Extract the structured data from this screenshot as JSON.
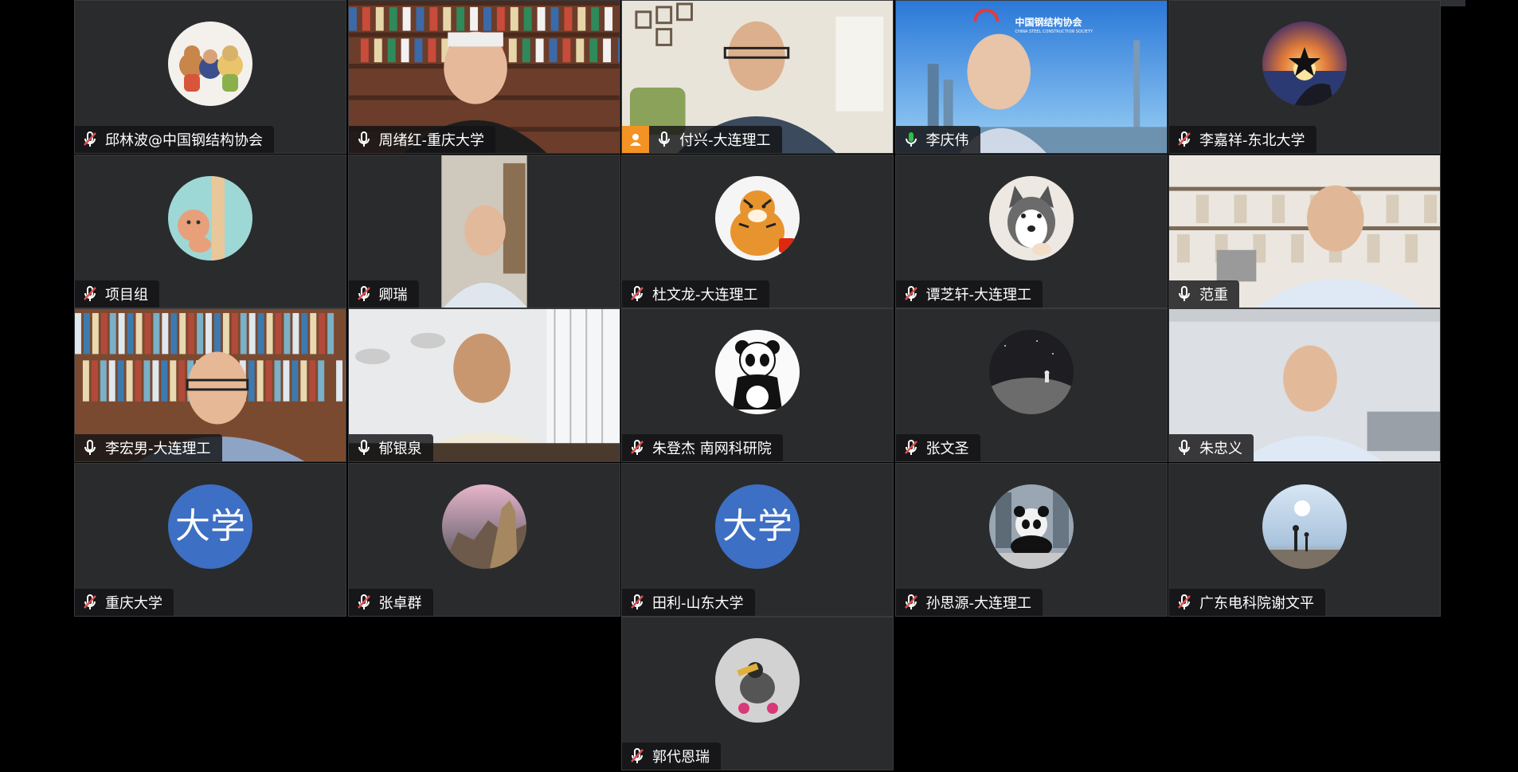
{
  "participants": [
    {
      "name": "邱林波@中国钢结构协会",
      "mic": "muted",
      "type": "avatar",
      "avatar": "teddy-bears-avatar"
    },
    {
      "name": "周绪红-重庆大学",
      "mic": "on",
      "type": "video",
      "scene": "bookshelf-man"
    },
    {
      "name": "付兴-大连理工",
      "mic": "on",
      "type": "video",
      "scene": "room-man",
      "host_badge": "host-icon"
    },
    {
      "name": "李庆伟",
      "mic": "speaking",
      "type": "video",
      "scene": "city-banner",
      "banner_text": "中国钢结构协会",
      "banner_sub": "CHINA STEEL CONSTRUCTION SOCIETY"
    },
    {
      "name": "李嘉祥-东北大学",
      "mic": "muted",
      "type": "avatar",
      "avatar": "sunset-avatar"
    },
    {
      "name": "项目组",
      "mic": "muted",
      "type": "avatar",
      "avatar": "cartoon-avatar"
    },
    {
      "name": "卿瑞",
      "mic": "muted",
      "type": "video",
      "scene": "portrait-narrow"
    },
    {
      "name": "杜文龙-大连理工",
      "mic": "muted",
      "type": "avatar",
      "avatar": "tiger-avatar"
    },
    {
      "name": "谭芝轩-大连理工",
      "mic": "muted",
      "type": "avatar",
      "avatar": "husky-avatar"
    },
    {
      "name": "范重",
      "mic": "on",
      "type": "video",
      "scene": "shelf-man"
    },
    {
      "name": "李宏男-大连理工",
      "mic": "on",
      "type": "video",
      "scene": "bookshelf-man2"
    },
    {
      "name": "郁银泉",
      "mic": "on",
      "type": "video",
      "scene": "white-room-man"
    },
    {
      "name": "朱登杰 南网科研院",
      "mic": "muted",
      "type": "avatar",
      "avatar": "panda-avatar"
    },
    {
      "name": "张文圣",
      "mic": "muted",
      "type": "avatar",
      "avatar": "moon-avatar"
    },
    {
      "name": "朱忠义",
      "mic": "on",
      "type": "video",
      "scene": "office-man"
    },
    {
      "name": "重庆大学",
      "mic": "muted",
      "type": "avatar-text",
      "avatar_text": "大学"
    },
    {
      "name": "张卓群",
      "mic": "muted",
      "type": "avatar",
      "avatar": "mountain-avatar"
    },
    {
      "name": "田利-山东大学",
      "mic": "muted",
      "type": "avatar-text",
      "avatar_text": "大学"
    },
    {
      "name": "孙思源-大连理工",
      "mic": "muted",
      "type": "avatar",
      "avatar": "panda-statue-avatar"
    },
    {
      "name": "广东电科院谢文平",
      "mic": "muted",
      "type": "avatar",
      "avatar": "beach-avatar"
    },
    {
      "name": "郭代恩瑞",
      "mic": "muted",
      "type": "avatar",
      "avatar": "scooter-avatar"
    }
  ],
  "colors": {
    "tile": "#2a2b2d",
    "speaking": "#2fbf4a",
    "muted": "#e05050",
    "host": "#f39324"
  }
}
